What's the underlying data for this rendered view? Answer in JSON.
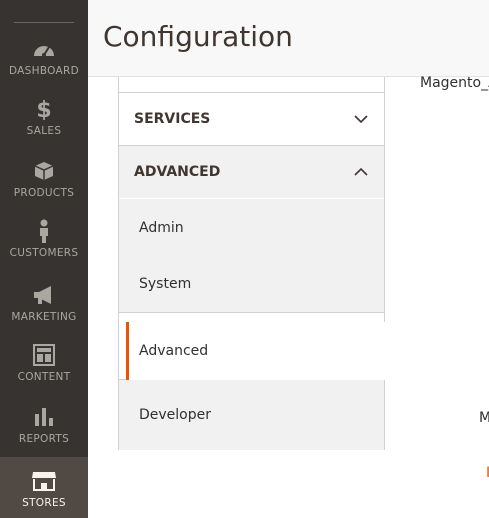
{
  "nav": {
    "items": [
      {
        "label": "DASHBOARD",
        "icon": "dashboard-icon"
      },
      {
        "label": "SALES",
        "icon": "dollar-icon"
      },
      {
        "label": "PRODUCTS",
        "icon": "box-icon"
      },
      {
        "label": "CUSTOMERS",
        "icon": "person-icon"
      },
      {
        "label": "MARKETING",
        "icon": "megaphone-icon"
      },
      {
        "label": "CONTENT",
        "icon": "layout-icon"
      },
      {
        "label": "REPORTS",
        "icon": "bar-chart-icon"
      },
      {
        "label": "STORES",
        "icon": "store-icon"
      }
    ],
    "active": "STORES",
    "background": "#373330",
    "active_background": "#514943"
  },
  "header": {
    "title": "Configuration"
  },
  "tabs": {
    "services_label": "SERVICES",
    "advanced_label": "ADVANCED",
    "sub_items": [
      "Admin",
      "System",
      "Advanced",
      "Developer"
    ],
    "active_sub": "Advanced",
    "accent": "#eb5202"
  },
  "main": {
    "partial_text_1": "Magento_A",
    "partial_text_2": "M",
    "partial_text_3": "I"
  }
}
